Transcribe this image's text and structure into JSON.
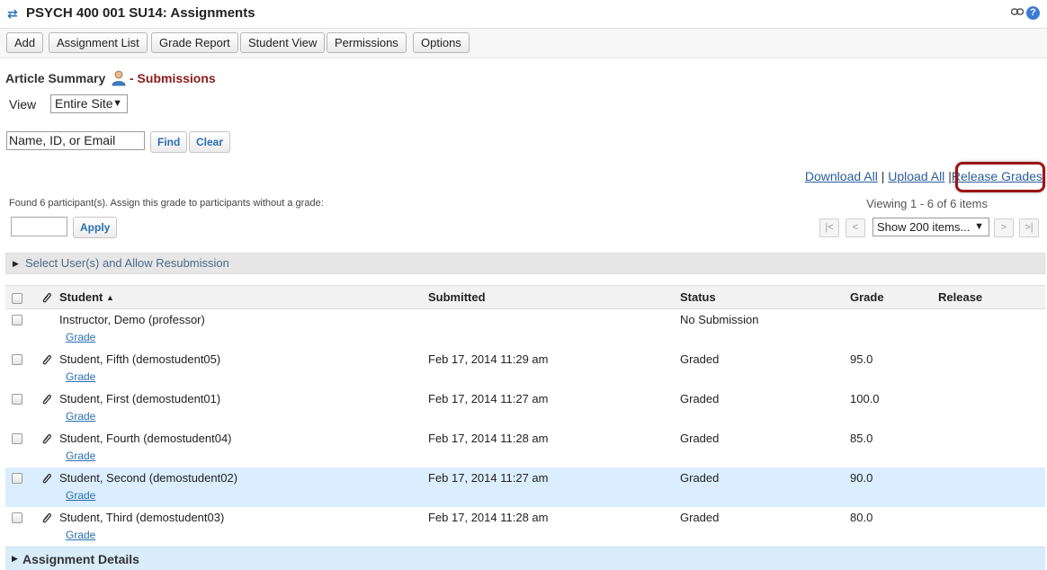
{
  "title": "PSYCH 400 001 SU14: Assignments",
  "toolbar": [
    {
      "label": "Add",
      "name": "add-button"
    },
    {
      "label": "Assignment List",
      "name": "assignment-list-button"
    },
    {
      "label": "Grade Report",
      "name": "grade-report-button"
    },
    {
      "label": "Student View",
      "name": "student-view-button"
    },
    {
      "label": "Permissions",
      "name": "permissions-button"
    },
    {
      "label": "Options",
      "name": "options-button"
    }
  ],
  "heading": {
    "title": "Article Summary",
    "sub": "- Submissions"
  },
  "view": {
    "label": "View",
    "selected": "Entire Site"
  },
  "search": {
    "value": "Name, ID, or Email",
    "find": "Find",
    "clear": "Clear"
  },
  "actions": {
    "download": "Download All",
    "upload": "Upload All",
    "release": "Release Grades",
    "separator": "|"
  },
  "found_text": "Found 6 participant(s). Assign this grade to participants without a grade:",
  "apply": "Apply",
  "viewing": "Viewing 1 - 6 of 6 items",
  "pager": {
    "first": "|<",
    "prev": "<",
    "page_size": "Show 200 items...",
    "next": ">",
    "last": ">|"
  },
  "toggle_label": "Select User(s) and Allow Resubmission",
  "table": {
    "headers": {
      "student": "Student",
      "sort_indicator": "▲",
      "submitted": "Submitted",
      "status": "Status",
      "grade": "Grade",
      "release": "Release"
    },
    "grade_link": "Grade",
    "rows": [
      {
        "name": "Instructor, Demo (professor)",
        "submitted": "",
        "status": "No Submission",
        "grade": "",
        "attachment": false,
        "highlighted": false
      },
      {
        "name": "Student, Fifth (demostudent05)",
        "submitted": "Feb 17, 2014 11:29 am",
        "status": "Graded",
        "grade": "95.0",
        "attachment": true,
        "highlighted": false
      },
      {
        "name": "Student, First (demostudent01)",
        "submitted": "Feb 17, 2014 11:27 am",
        "status": "Graded",
        "grade": "100.0",
        "attachment": true,
        "highlighted": false
      },
      {
        "name": "Student, Fourth (demostudent04)",
        "submitted": "Feb 17, 2014 11:28 am",
        "status": "Graded",
        "grade": "85.0",
        "attachment": true,
        "highlighted": false
      },
      {
        "name": "Student, Second (demostudent02)",
        "submitted": "Feb 17, 2014 11:27 am",
        "status": "Graded",
        "grade": "90.0",
        "attachment": true,
        "highlighted": true
      },
      {
        "name": "Student, Third (demostudent03)",
        "submitted": "Feb 17, 2014 11:28 am",
        "status": "Graded",
        "grade": "80.0",
        "attachment": true,
        "highlighted": false
      }
    ]
  },
  "details_label": "Assignment Details",
  "colors": {
    "accent": "#8b1a1a",
    "link": "#2a6fb0",
    "callout": "#9a1515",
    "row_highlight": "#dbeeff"
  }
}
